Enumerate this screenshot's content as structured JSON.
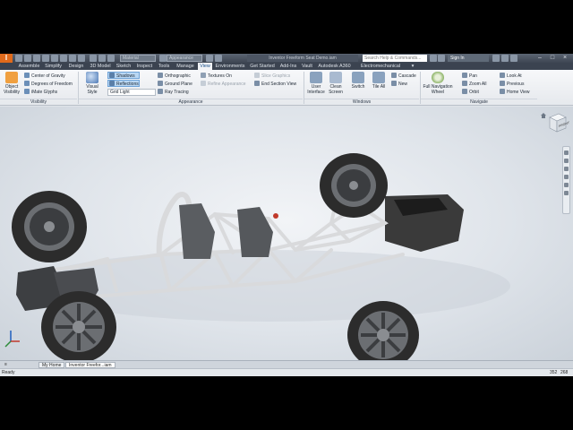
{
  "app": {
    "logo": "I",
    "title": "Inventor Freeform Seat Demo.iam",
    "search_placeholder": "Search Help & Commands...",
    "sign_in": "Sign In",
    "material": "Material",
    "appearance": "Appearance"
  },
  "tabs": [
    "Assemble",
    "Simplify",
    "Design",
    "3D Model",
    "Sketch",
    "Inspect",
    "Tools",
    "Manage",
    "View",
    "Environments",
    "Get Started",
    "Add-Ins",
    "Vault",
    "Autodesk A360",
    "Electromechanical"
  ],
  "active_tab": "View",
  "ribbon": {
    "visibility": {
      "title": "Visibility",
      "object_visibility": "Object Visibility",
      "items": [
        "Center of Gravity",
        "Degrees of Freedom",
        "iMate Glyphs"
      ]
    },
    "appearance": {
      "title": "Appearance",
      "visual_style": "Visual Style",
      "shadows": "Shadows",
      "reflections": "Reflections",
      "grid_light": "Grid Light",
      "orthographic": "Orthographic",
      "ground_plane": "Ground Plane",
      "ray_tracing": "Ray Tracing",
      "textures_on": "Textures On",
      "refine_appearance": "Refine Appearance",
      "slice_graphics": "Slice Graphics",
      "end_section_view": "End Section View"
    },
    "windows": {
      "title": "Windows",
      "user_interface": "User Interface",
      "clean_screen": "Clean Screen",
      "switch": "Switch",
      "tile_all": "Tile All",
      "cascade": "Cascade",
      "new": "New"
    },
    "navigate": {
      "title": "Navigate",
      "full_nav_wheel": "Full Navigation Wheel",
      "pan": "Pan",
      "zoom_all": "Zoom All",
      "orbit": "Orbit",
      "look_at": "Look At",
      "previous": "Previous",
      "home_view": "Home View"
    }
  },
  "viewcube_label": "FRONT",
  "doc_tabs": [
    "My Home",
    "Inventor Freefor...iam"
  ],
  "status": {
    "text": "Ready",
    "num1": "352",
    "num2": "268"
  },
  "colors": {
    "accent": "#e06a1b",
    "chrome_dark": "#3b4350",
    "active_tab_text": "#1a4f8a"
  }
}
